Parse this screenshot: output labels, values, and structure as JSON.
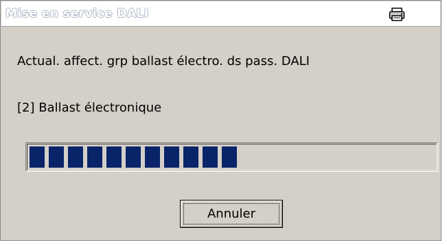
{
  "dialog": {
    "title": "Mise en service DALI",
    "status_line": "Actual. affect. grp ballast électro. ds pass. DALI",
    "device_line": "[2] Ballast électronique",
    "progress": {
      "filled_chunks": 11,
      "total_chunks": 21,
      "color": "#0a246a"
    },
    "cancel_label": "Annuler",
    "title_icon": "printer-icon"
  }
}
